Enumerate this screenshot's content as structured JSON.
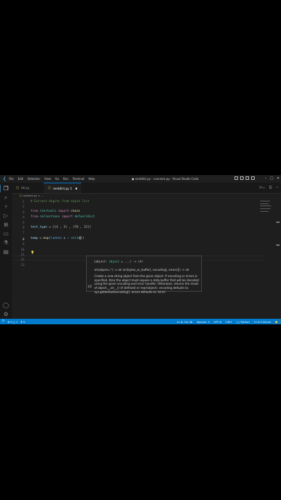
{
  "window": {
    "title": "● nestdict.py - coursera.py - Visual Studio Code",
    "menu": [
      "File",
      "Edit",
      "Selection",
      "View",
      "Go",
      "Run",
      "Terminal",
      "Help"
    ]
  },
  "tabs": [
    {
      "label": "stt.py",
      "active": false
    },
    {
      "label": "nestdict.py 1",
      "active": true
    }
  ],
  "breadcrumb": "nestdict.py > ...",
  "editor": {
    "line_numbers": [
      "1",
      "2",
      "3",
      "4",
      "5",
      "6",
      "7",
      "8",
      "9",
      "10",
      "11",
      "12",
      "13"
    ],
    "current_line": "8",
    "lines": [
      [
        {
          "t": "# Extract digits from tuple list",
          "c": "c-com"
        }
      ],
      [],
      [
        {
          "t": "from ",
          "c": "c-kw"
        },
        {
          "t": "itertools ",
          "c": "c-mod"
        },
        {
          "t": "import ",
          "c": "c-kw"
        },
        {
          "t": "chain",
          "c": "c-fn"
        }
      ],
      [
        {
          "t": "from ",
          "c": "c-kw"
        },
        {
          "t": "collections ",
          "c": "c-mod"
        },
        {
          "t": "import ",
          "c": "c-kw"
        },
        {
          "t": "defaultdict",
          "c": "c-mod"
        }
      ],
      [],
      [
        {
          "t": "test_type",
          "c": "c-var"
        },
        {
          "t": " = [(",
          "c": "c-op"
        },
        {
          "t": "4",
          "c": "c-num"
        },
        {
          "t": " , ",
          "c": "c-op"
        },
        {
          "t": "2",
          "c": "c-num"
        },
        {
          "t": ") , (",
          "c": "c-op"
        },
        {
          "t": "78",
          "c": "c-num"
        },
        {
          "t": " , ",
          "c": "c-op"
        },
        {
          "t": "12",
          "c": "c-num"
        },
        {
          "t": ")]",
          "c": "c-op"
        }
      ],
      [],
      [
        {
          "t": "temp",
          "c": "c-var"
        },
        {
          "t": " = ",
          "c": "c-op"
        },
        {
          "t": "map",
          "c": "c-fn"
        },
        {
          "t": "(",
          "c": "c-op"
        },
        {
          "t": "lambda ",
          "c": "c-blue"
        },
        {
          "t": "x",
          "c": "c-var"
        },
        {
          "t": " : ",
          "c": "c-op"
        },
        {
          "t": "str",
          "c": "c-mod"
        },
        {
          "t": "(x",
          "c": "c-var"
        }
      ],
      [],
      [],
      [],
      [],
      []
    ],
    "line8_tail": "))"
  },
  "hover": {
    "signature_open": "(object: ",
    "signature_type": "object",
    "signature_close": " = ...) -> str",
    "counter": "1/2",
    "overload": "str(object='') -> str str(bytes_or_buffer[, encoding[, errors]]) -> str",
    "doc": "Create a new string object from the given object. If encoding or errors is specified, then the object must expose a data buffer that will be decoded using the given encoding and error handler. Otherwise, returns the result of object.__str__() (if defined) or repr(object). encoding defaults to sys.getdefaultencoding(). errors defaults to 'strict'."
  },
  "status": {
    "left_errors": "⊗ 0 △ 1",
    "left_ports": "⚲ 0",
    "position": "Ln 8, Col 28",
    "spaces": "Spaces: 4",
    "encoding": "UTF-8",
    "eol": "CRLF",
    "language": "{} Python",
    "interpreter": "3.10.5 64-bit"
  },
  "colors": {
    "accent": "#007acc",
    "editor_bg": "#1e1e1e"
  },
  "icons": [
    "vscode-logo-icon",
    "explorer-icon",
    "search-icon",
    "source-control-icon",
    "run-debug-icon",
    "extensions-icon",
    "remote-explorer-icon",
    "testing-icon",
    "accounts-icon",
    "manage-gear-icon",
    "run-icon",
    "split-editor-icon",
    "more-icon",
    "lightbulb-icon",
    "remote-icon"
  ]
}
